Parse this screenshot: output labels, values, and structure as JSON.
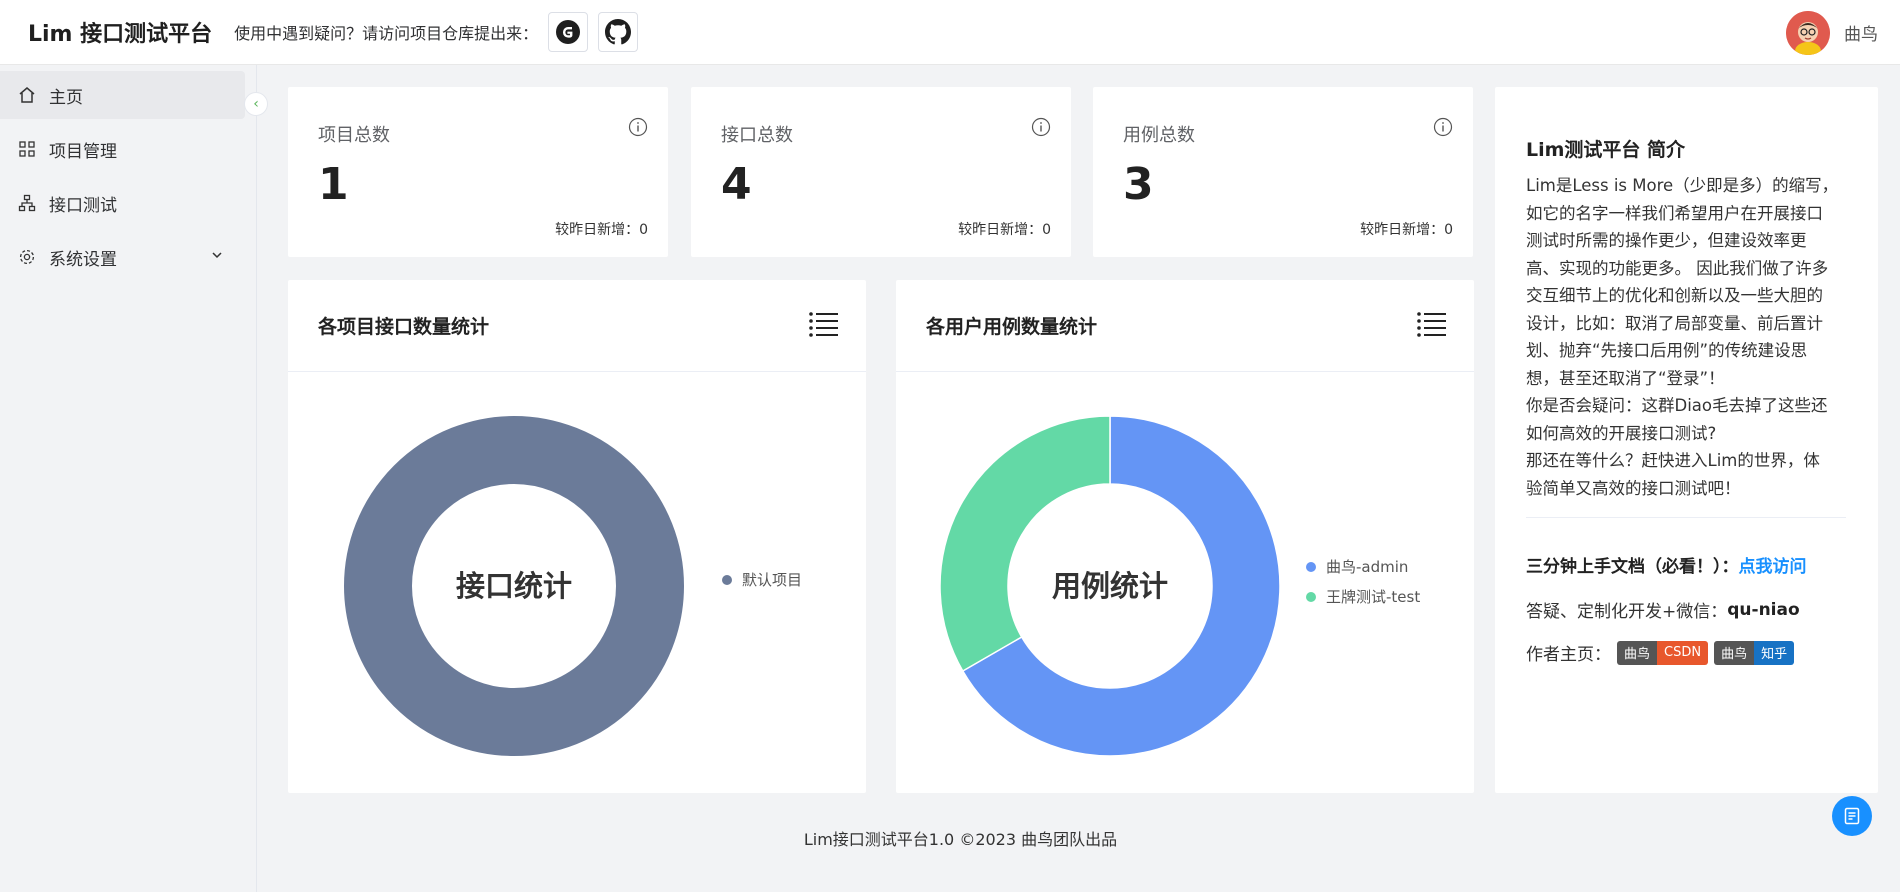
{
  "header": {
    "logo": "Lim 接口测试平台",
    "help_text": "使用中遇到疑问？请访问项目仓库提出来：",
    "username": "曲鸟"
  },
  "sidebar": {
    "items": [
      {
        "label": "主页",
        "icon": "home-icon"
      },
      {
        "label": "项目管理",
        "icon": "grid-icon"
      },
      {
        "label": "接口测试",
        "icon": "sitemap-icon"
      },
      {
        "label": "系统设置",
        "icon": "gear-icon"
      }
    ]
  },
  "stats": [
    {
      "title": "项目总数",
      "value": "1",
      "sub_label": "较昨日新增：",
      "sub_value": "0"
    },
    {
      "title": "接口总数",
      "value": "4",
      "sub_label": "较昨日新增：",
      "sub_value": "0"
    },
    {
      "title": "用例总数",
      "value": "3",
      "sub_label": "较昨日新增：",
      "sub_value": "0"
    }
  ],
  "chart_data": [
    {
      "type": "pie",
      "title": "各项目接口数量统计",
      "center_label": "接口统计",
      "labels": [
        "默认项目"
      ],
      "values": [
        4
      ],
      "colors": [
        "#6b7b99"
      ],
      "legend": "right"
    },
    {
      "type": "pie",
      "title": "各用户用例数量统计",
      "center_label": "用例统计",
      "labels": [
        "曲鸟-admin",
        "王牌测试-test"
      ],
      "values": [
        2,
        1
      ],
      "colors": [
        "#6495f5",
        "#63d9a6"
      ],
      "legend": "right"
    }
  ],
  "intro": {
    "title": "Lim测试平台 简介",
    "body_lines": [
      "Lim是Less is More（少即是多）的缩写，",
      "如它的名字一样我们希望用户在开展接口",
      "测试时所需的操作更少，但建设效率更",
      "高、实现的功能更多。 因此我们做了许多",
      "交互细节上的优化和创新以及一些大胆的",
      "设计，比如：取消了局部变量、前后置计",
      "划、抛弃“先接口后用例”的传统建设思",
      "想，甚至还取消了“登录”！",
      "你是否会疑问：这群Diao毛去掉了这些还",
      "如何高效的开展接口测试?",
      "那还在等什么？赶快进入Lim的世界，体",
      "验简单又高效的接口测试吧！"
    ],
    "doc_label": "三分钟上手文档（必看！）：",
    "doc_link": "点我访问",
    "contact_label": "答疑、定制化开发+微信：",
    "contact_value": "qu-niao",
    "author_label": "作者主页：",
    "badge1_left": "曲鸟",
    "badge1_right": "CSDN",
    "badge1_color": "#e8572c",
    "badge2_left": "曲鸟",
    "badge2_right": "知乎",
    "badge2_color": "#1772c4"
  },
  "footer": "Lim接口测试平台1.0 ©2023 曲鸟团队出品"
}
